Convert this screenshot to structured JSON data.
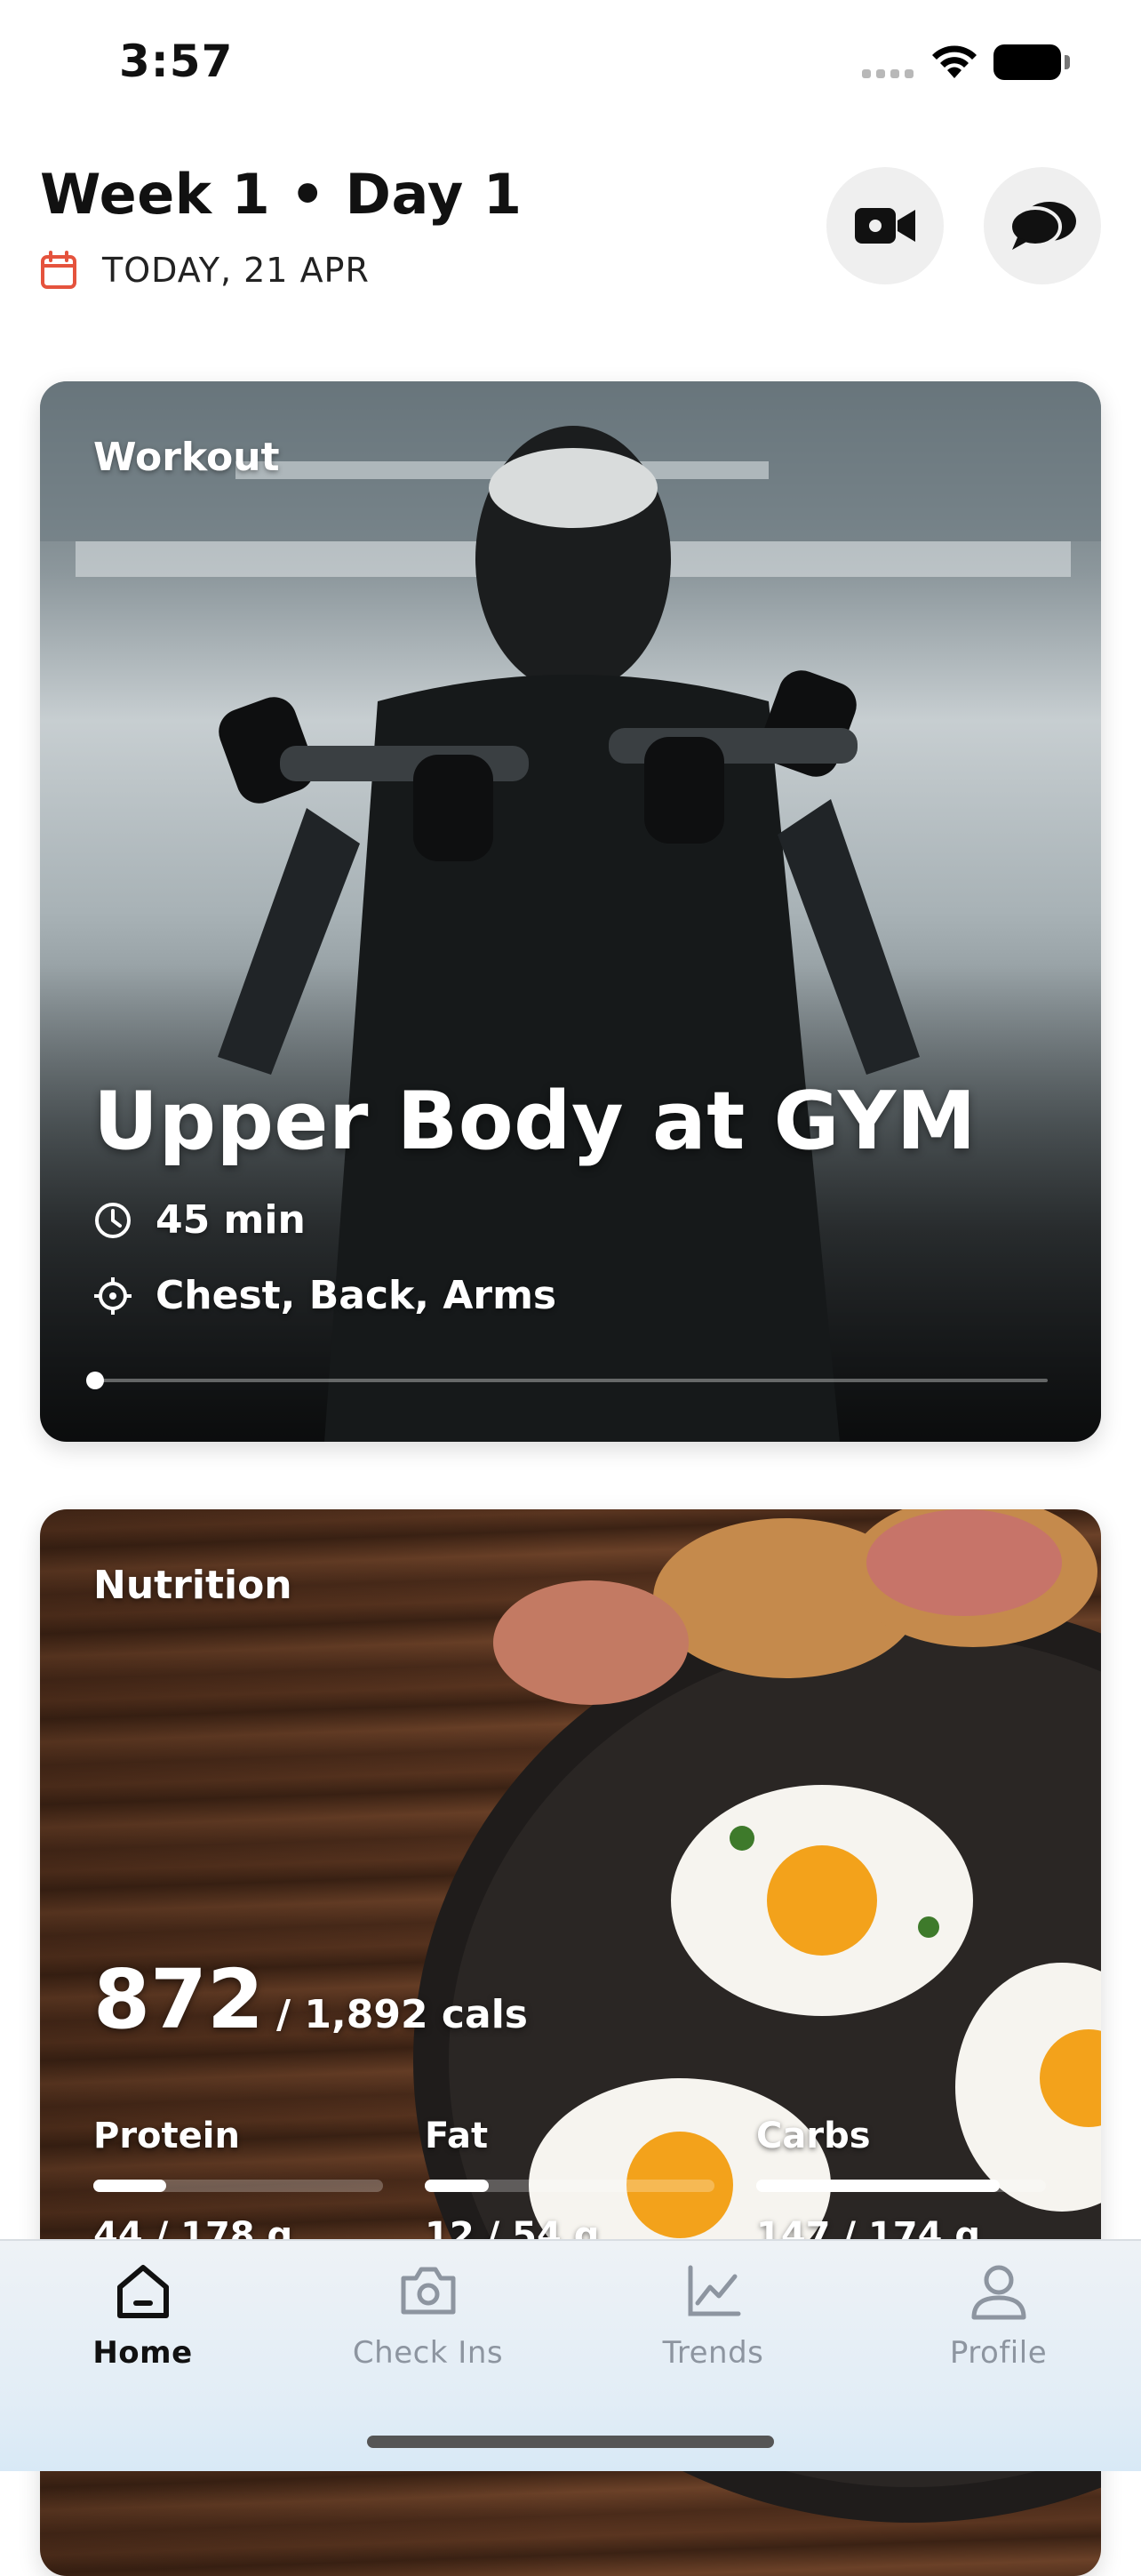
{
  "status_bar": {
    "time": "3:57"
  },
  "header": {
    "title": "Week 1 • Day 1",
    "date": "TODAY, 21 APR"
  },
  "workout": {
    "label": "Workout",
    "title": "Upper Body at GYM",
    "duration": "45 min",
    "muscles": "Chest, Back, Arms",
    "progress": 0.0
  },
  "nutrition": {
    "label": "Nutrition",
    "calories_eaten": "872",
    "calories_target": "/  1,892 cals",
    "macros": [
      {
        "name": "Protein",
        "value": "44 / 178 g",
        "progress": 0.25
      },
      {
        "name": "Fat",
        "value": "12 / 54 g",
        "progress": 0.22
      },
      {
        "name": "Carbs",
        "value": "147 / 174 g",
        "progress": 0.84
      }
    ]
  },
  "tab_bar": {
    "tabs": [
      {
        "label": "Home",
        "icon": "home-icon",
        "active": true
      },
      {
        "label": "Check Ins",
        "icon": "camera-icon",
        "active": false
      },
      {
        "label": "Trends",
        "icon": "chart-icon",
        "active": false
      },
      {
        "label": "Profile",
        "icon": "person-icon",
        "active": false
      }
    ]
  },
  "colors": {
    "accent_red": "#e5533d",
    "tab_inactive": "#8d95a0",
    "tab_active": "#111111"
  }
}
